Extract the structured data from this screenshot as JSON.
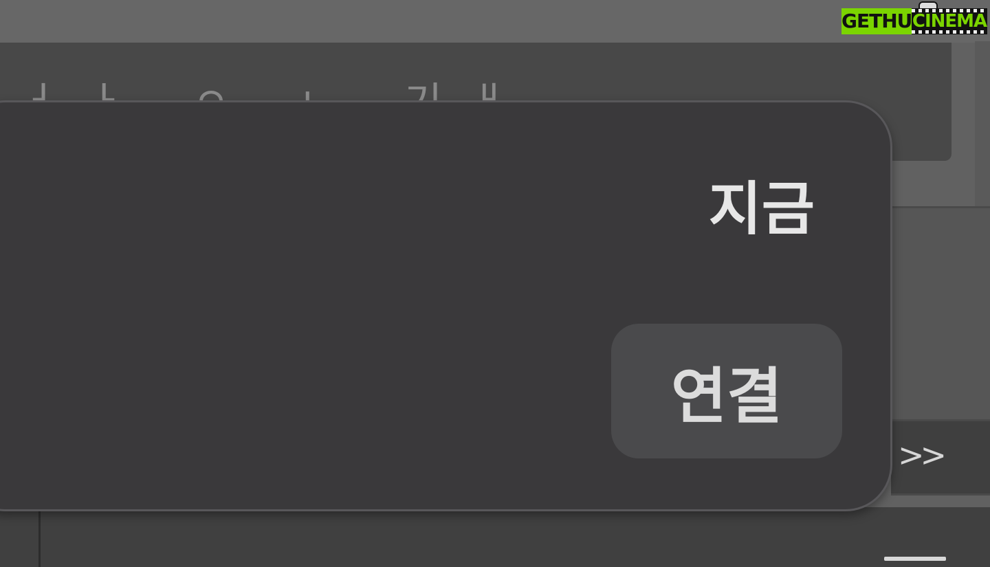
{
  "background": {
    "panel_text": "ㅓㅏ ㅇ ㄴ 기ㅐ"
  },
  "notification": {
    "time": "지금",
    "action_label": "연결"
  },
  "sidebar": {
    "expand_label": ">>"
  },
  "watermark": {
    "left_text": "GETHU",
    "right_text": "CINEMA"
  },
  "colors": {
    "card_bg": "#3a393b",
    "button_bg": "#4a4a4c",
    "accent_green": "#7bd400"
  }
}
